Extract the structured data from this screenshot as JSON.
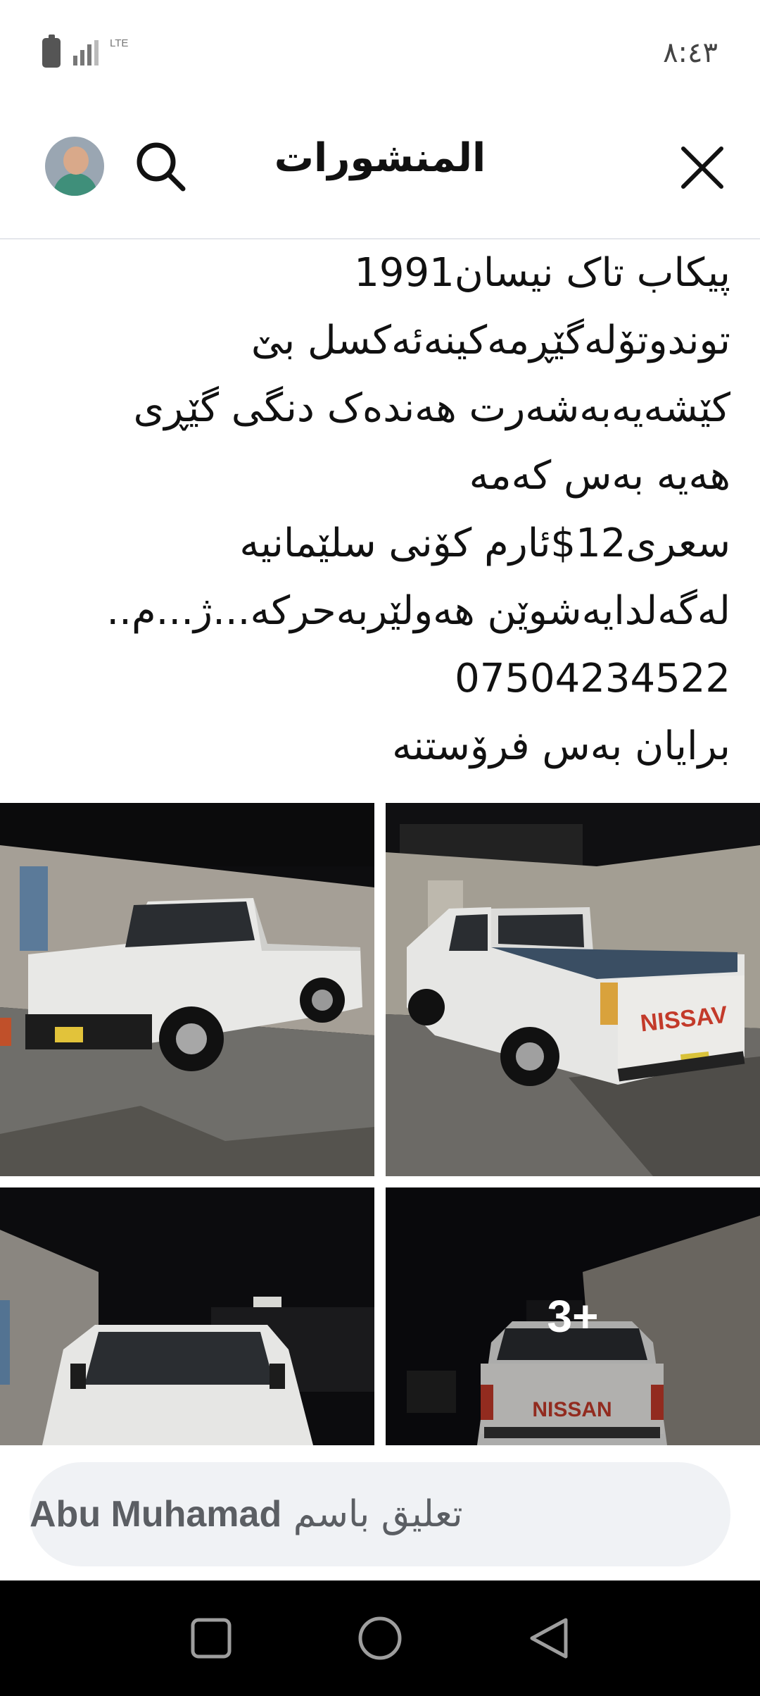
{
  "status_bar": {
    "time": "٨:٤٣",
    "network": "LTE",
    "battery_icon": "battery-icon",
    "signal_icon": "signal-icon"
  },
  "header": {
    "title": "المنشورات",
    "close_icon": "close-icon",
    "search_icon": "search-icon",
    "avatar_icon": "avatar"
  },
  "post": {
    "lines": [
      "پیکاب تاک نیسان1991",
      "توندوتۆلەگێڕمەکینەئەکسل بێ",
      "کێشەیەبەشەرت هەندەک دنگی گێڕی",
      "هەیە بەس کەمە",
      "سعری12$ئارم کۆنی سلێمانیە",
      "لەگەلدایەشوێن هەولێربەحرکە...ژ...م..",
      "07504234522",
      "برایان بەس فرۆستنە"
    ]
  },
  "photos": {
    "more_count": "3+",
    "plate_text": "NISSAV",
    "plate_text_2": "NISSAN"
  },
  "comment": {
    "prefix": "تعليق باسم",
    "name": "Abu Muhamad"
  },
  "nav": {
    "recents_icon": "square-icon",
    "home_icon": "circle-icon",
    "back_icon": "triangle-back-icon"
  },
  "colors": {
    "background": "#ffffff",
    "comment_bg": "#f0f2f5",
    "nav_bg": "#000000",
    "text": "#1c1e21"
  }
}
